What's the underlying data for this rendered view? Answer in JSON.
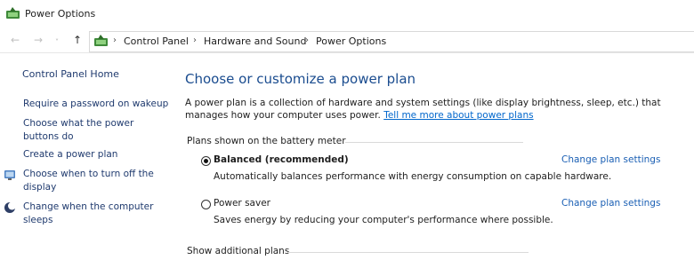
{
  "window": {
    "title": "Power Options"
  },
  "nav": {
    "back_glyph": "←",
    "forward_glyph": "→",
    "recent_glyph": "˅",
    "up_glyph": "↑",
    "breadcrumbs": [
      "Control Panel",
      "Hardware and Sound",
      "Power Options"
    ],
    "separator": "›"
  },
  "sidebar": {
    "home": "Control Panel Home",
    "links": [
      {
        "label": "Require a password on wakeup",
        "icon": ""
      },
      {
        "label": "Choose what the power buttons do",
        "icon": ""
      },
      {
        "label": "Create a power plan",
        "icon": ""
      },
      {
        "label": "Choose when to turn off the display",
        "icon": "display-timer-icon"
      },
      {
        "label": "Change when the computer sleeps",
        "icon": "sleep-moon-icon"
      }
    ]
  },
  "main": {
    "heading": "Choose or customize a power plan",
    "description": "A power plan is a collection of hardware and system settings (like display brightness, sleep, etc.) that manages how your computer uses power.",
    "description_link": "Tell me more about power plans",
    "battery_group_label": "Plans shown on the battery meter",
    "plans": [
      {
        "name": "Balanced (recommended)",
        "description": "Automatically balances performance with energy consumption on capable hardware.",
        "selected": true,
        "change_link": "Change plan settings"
      },
      {
        "name": "Power saver",
        "description": "Saves energy by reducing your computer's performance where possible.",
        "selected": false,
        "change_link": "Change plan settings"
      }
    ],
    "additional_plans_label": "Show additional plans"
  },
  "colors": {
    "heading": "#1a4c8f",
    "link": "#1a5fb4",
    "sidebar_link": "#1f3a6e"
  }
}
